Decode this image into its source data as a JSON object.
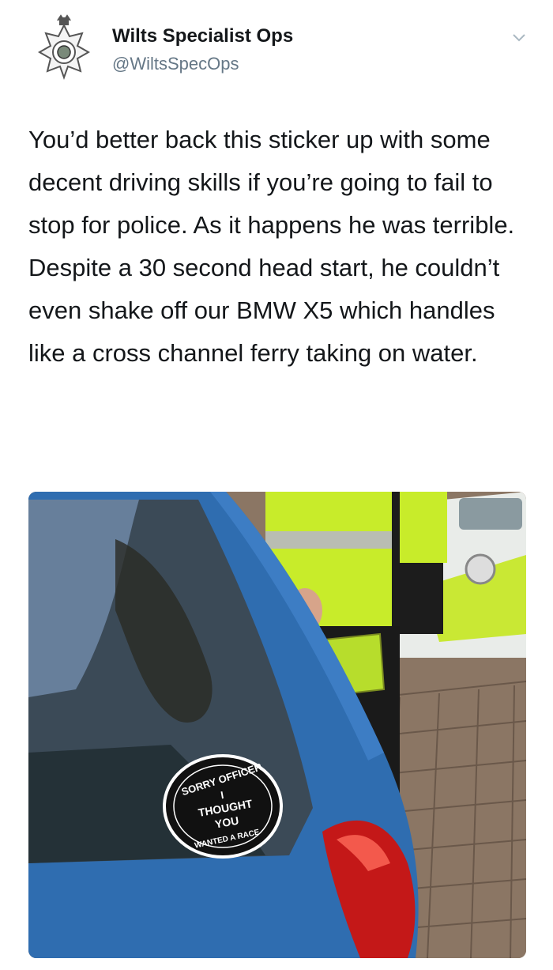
{
  "account": {
    "name": "Wilts Specialist Ops",
    "handle": "@WiltsSpecOps",
    "avatar_icon": "police-badge-icon"
  },
  "menu_icon": "chevron-down-icon",
  "tweet": {
    "text": "You’d better back this sticker up with some decent driving skills if you’re going to fail to stop for police. As it happens he was terrible. Despite a 30 second head start, he couldn’t even shake off our BMW X5 which handles like a cross channel ferry taking on water."
  },
  "photo": {
    "sticker_lines": [
      "SORRY OFFICER",
      "I",
      "THOUGHT",
      "YOU",
      "WANTED A RACE"
    ]
  },
  "colors": {
    "car_blue": "#2f6db0",
    "hi_vis": "#c8ec2a",
    "text": "#14171a",
    "muted": "#657786"
  }
}
